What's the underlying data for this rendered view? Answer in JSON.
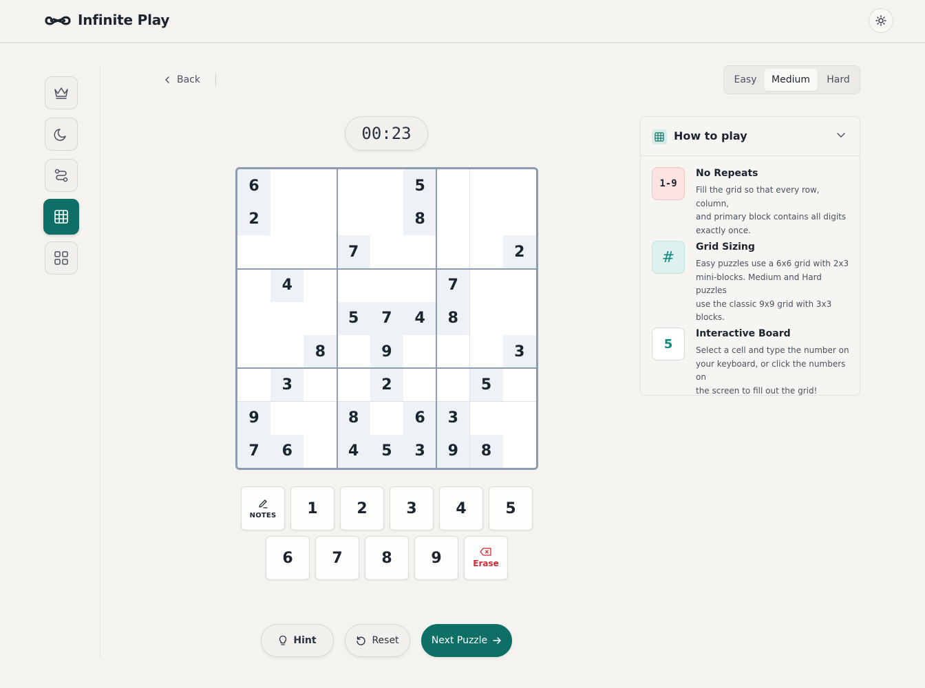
{
  "app": {
    "title": "Infinite Play"
  },
  "nav": {
    "back_label": "Back"
  },
  "difficulty": {
    "options": [
      "Easy",
      "Medium",
      "Hard"
    ],
    "selected": "Medium"
  },
  "timer": {
    "value": "00:23"
  },
  "board": {
    "size": 9,
    "cells": [
      [
        6,
        null,
        null,
        null,
        null,
        5,
        null,
        null,
        null
      ],
      [
        2,
        null,
        null,
        null,
        null,
        8,
        null,
        null,
        null
      ],
      [
        null,
        null,
        null,
        7,
        null,
        null,
        null,
        null,
        2
      ],
      [
        null,
        4,
        null,
        null,
        null,
        null,
        7,
        null,
        null
      ],
      [
        null,
        null,
        null,
        5,
        7,
        4,
        8,
        null,
        null
      ],
      [
        null,
        null,
        8,
        null,
        9,
        null,
        null,
        null,
        3
      ],
      [
        null,
        3,
        null,
        null,
        2,
        null,
        null,
        5,
        null
      ],
      [
        9,
        null,
        null,
        8,
        null,
        6,
        3,
        null,
        null
      ],
      [
        7,
        6,
        null,
        4,
        5,
        3,
        9,
        8,
        null
      ]
    ]
  },
  "pad": {
    "notes_label": "NOTES",
    "row1": [
      "1",
      "2",
      "3",
      "4",
      "5"
    ],
    "row2": [
      "6",
      "7",
      "8",
      "9"
    ],
    "erase_label": "Erase"
  },
  "actions": {
    "hint": "Hint",
    "reset": "Reset",
    "next": "Next Puzzle"
  },
  "howto": {
    "title": "How to play",
    "rules": [
      {
        "icon_text": "1-9",
        "title": "No Repeats",
        "lines": [
          "Fill the grid so that every row, column,",
          "and primary block contains all digits",
          "exactly once."
        ]
      },
      {
        "icon_text": "#",
        "title": "Grid Sizing",
        "lines": [
          "Easy puzzles use a 6x6 grid with 2x3",
          "mini-blocks. Medium and Hard puzzles",
          "use the classic 9x9 grid with 3x3",
          "blocks."
        ]
      },
      {
        "icon_text": "5",
        "title": "Interactive Board",
        "lines": [
          "Select a cell and type the number on",
          "your keyboard, or click the numbers on",
          "the screen to fill out the grid!"
        ]
      }
    ]
  },
  "colors": {
    "accent": "#0d6f66",
    "board_border": "#8d9bb0",
    "given_cell": "#eef1f6",
    "erase": "#d02a35"
  }
}
